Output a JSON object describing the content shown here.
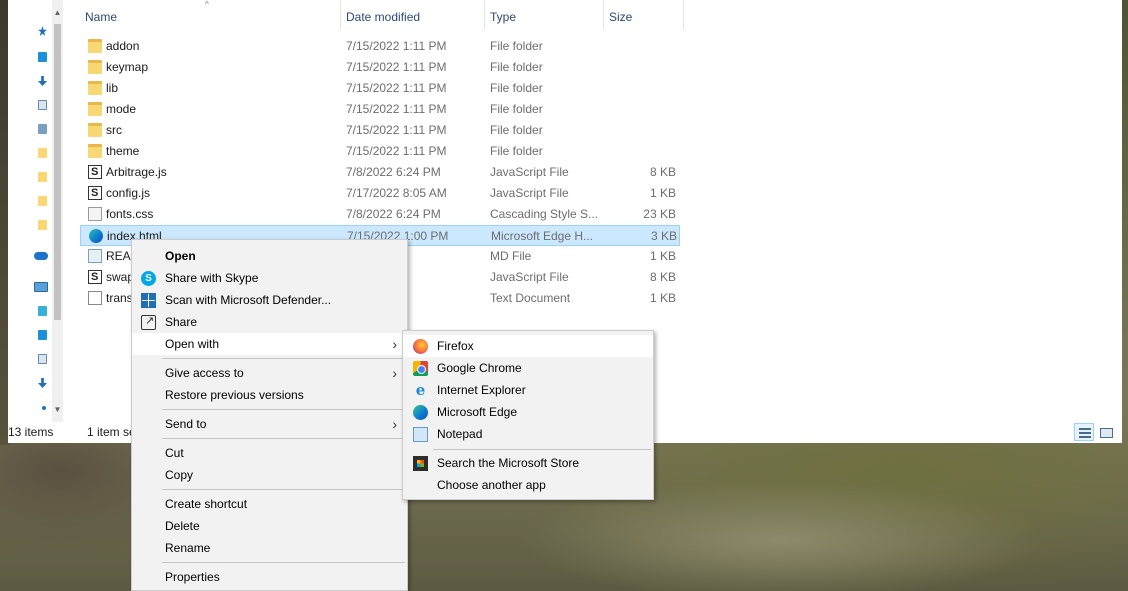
{
  "columns": {
    "name": "Name",
    "date_modified": "Date modified",
    "type": "Type",
    "size": "Size"
  },
  "files": [
    {
      "name": "addon",
      "date": "7/15/2022 1:11 PM",
      "type": "File folder",
      "size": "",
      "icon": "folder-icon"
    },
    {
      "name": "keymap",
      "date": "7/15/2022 1:11 PM",
      "type": "File folder",
      "size": "",
      "icon": "folder-icon"
    },
    {
      "name": "lib",
      "date": "7/15/2022 1:11 PM",
      "type": "File folder",
      "size": "",
      "icon": "folder-icon"
    },
    {
      "name": "mode",
      "date": "7/15/2022 1:11 PM",
      "type": "File folder",
      "size": "",
      "icon": "folder-icon"
    },
    {
      "name": "src",
      "date": "7/15/2022 1:11 PM",
      "type": "File folder",
      "size": "",
      "icon": "folder-icon"
    },
    {
      "name": "theme",
      "date": "7/15/2022 1:11 PM",
      "type": "File folder",
      "size": "",
      "icon": "folder-icon"
    },
    {
      "name": "Arbitrage.js",
      "date": "7/8/2022 6:24 PM",
      "type": "JavaScript File",
      "size": "8 KB",
      "icon": "js-file-icon"
    },
    {
      "name": "config.js",
      "date": "7/17/2022 8:05 AM",
      "type": "JavaScript File",
      "size": "1 KB",
      "icon": "js-file-icon"
    },
    {
      "name": "fonts.css",
      "date": "7/8/2022 6:24 PM",
      "type": "Cascading Style S...",
      "size": "23 KB",
      "icon": "css-file-icon"
    },
    {
      "name": "index.html",
      "date": "7/15/2022 1:00 PM",
      "type": "Microsoft Edge H...",
      "size": "3 KB",
      "icon": "edge-file-icon",
      "selected": true
    },
    {
      "name": "READ",
      "date": "10 PM",
      "type": "MD File",
      "size": "1 KB",
      "icon": "md-file-icon"
    },
    {
      "name": "swap",
      "date": "4 PM",
      "type": "JavaScript File",
      "size": "8 KB",
      "icon": "js-file-icon"
    },
    {
      "name": "trans",
      "date": "4 PM",
      "type": "Text Document",
      "size": "1 KB",
      "icon": "text-file-icon"
    }
  ],
  "status_bar": {
    "item_count": "13 items",
    "selection": "1 item se"
  },
  "context_menu": {
    "open": "Open",
    "share_skype": "Share with Skype",
    "scan_defender": "Scan with Microsoft Defender...",
    "share": "Share",
    "open_with": "Open with",
    "give_access": "Give access to",
    "restore_versions": "Restore previous versions",
    "send_to": "Send to",
    "cut": "Cut",
    "copy": "Copy",
    "create_shortcut": "Create shortcut",
    "delete": "Delete",
    "rename": "Rename",
    "properties": "Properties"
  },
  "open_with_menu": {
    "firefox": "Firefox",
    "chrome": "Google Chrome",
    "ie": "Internet Explorer",
    "edge": "Microsoft Edge",
    "notepad": "Notepad",
    "store": "Search the Microsoft Store",
    "another": "Choose another app"
  },
  "colors": {
    "selection_bg": "#cce8ff",
    "selection_border": "#99d1ff",
    "menu_bg": "#f2f2f2",
    "header_text": "#2b4a75"
  }
}
